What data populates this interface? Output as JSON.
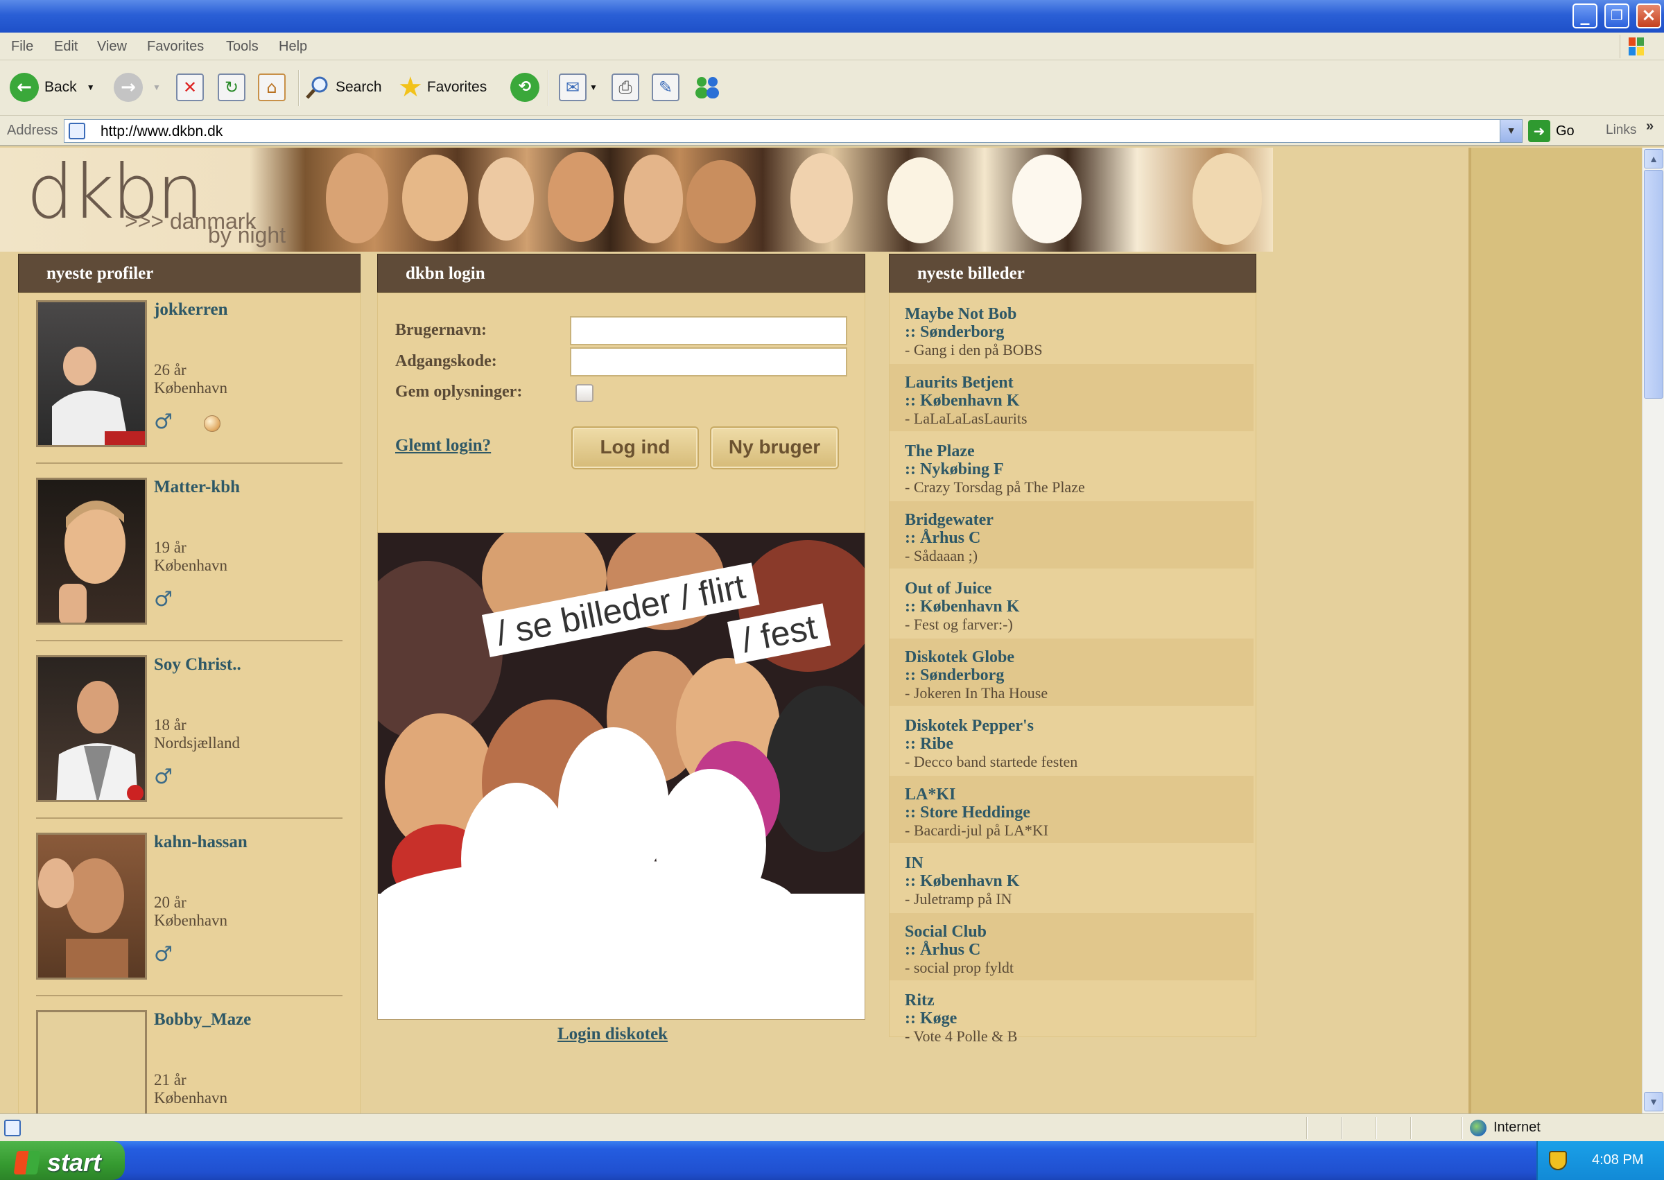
{
  "browser": {
    "menu": [
      "File",
      "Edit",
      "View",
      "Favorites",
      "Tools",
      "Help"
    ],
    "toolbar": {
      "back": "Back",
      "search": "Search",
      "favorites": "Favorites"
    },
    "address": {
      "label": "Address",
      "url": "http://www.dkbn.dk",
      "go": "Go",
      "links": "Links"
    },
    "status": {
      "zone": "Internet"
    }
  },
  "site": {
    "logo": {
      "main": "dkbn",
      "sub1": ">>> danmark",
      "sub2": "by night"
    },
    "profiles_header": "nyeste profiler",
    "profiles": [
      {
        "name": "jokkerren",
        "age": "26 år",
        "city": "København",
        "gender": "♂"
      },
      {
        "name": "Matter-kbh",
        "age": "19 år",
        "city": "København",
        "gender": "♂"
      },
      {
        "name": "Soy Christ..",
        "age": "18 år",
        "city": "Nordsjælland",
        "gender": "♂"
      },
      {
        "name": "kahn-hassan",
        "age": "20 år",
        "city": "København",
        "gender": "♂"
      },
      {
        "name": "Bobby_Maze",
        "age": "21 år",
        "city": "København"
      }
    ],
    "login": {
      "header": "dkbn login",
      "username_label": "Brugernavn:",
      "password_label": "Adgangskode:",
      "remember_label": "Gem oplysninger:",
      "forgot": "Glemt login?",
      "login_button": "Log ind",
      "new_user_button": "Ny bruger"
    },
    "promo": {
      "line1": "/ se billeder / flirt",
      "line2": "/ fest"
    },
    "login_disco": "Login diskotek",
    "pictures_header": "nyeste billeder",
    "pictures": [
      {
        "venue": "Maybe Not Bob",
        "city": ":: Sønderborg",
        "caption": "-  Gang i den på BOBS"
      },
      {
        "venue": "Laurits Betjent",
        "city": ":: København K",
        "caption": "-  LaLaLaLasLaurits"
      },
      {
        "venue": "The Plaze",
        "city": ":: Nykøbing F",
        "caption": "-  Crazy Torsdag på The Plaze"
      },
      {
        "venue": "Bridgewater",
        "city": ":: Århus C",
        "caption": "-  Sådaaan ;)"
      },
      {
        "venue": "Out of Juice",
        "city": ":: København K",
        "caption": "-  Fest og farver:-)"
      },
      {
        "venue": "Diskotek Globe",
        "city": ":: Sønderborg",
        "caption": "-  Jokeren In Tha House"
      },
      {
        "venue": "Diskotek Pepper's",
        "city": ":: Ribe",
        "caption": "-  Decco band startede festen"
      },
      {
        "venue": "LA*KI",
        "city": ":: Store Heddinge",
        "caption": "-  Bacardi-jul på LA*KI"
      },
      {
        "venue": "IN",
        "city": ":: København K",
        "caption": "-  Juletramp på IN"
      },
      {
        "venue": "Social Club",
        "city": ":: Århus C",
        "caption": "-  social prop fyldt"
      },
      {
        "venue": "Ritz",
        "city": ":: Køge",
        "caption": "-  Vote 4 Polle & B"
      }
    ]
  },
  "taskbar": {
    "start": "start",
    "clock": "4:08 PM"
  }
}
